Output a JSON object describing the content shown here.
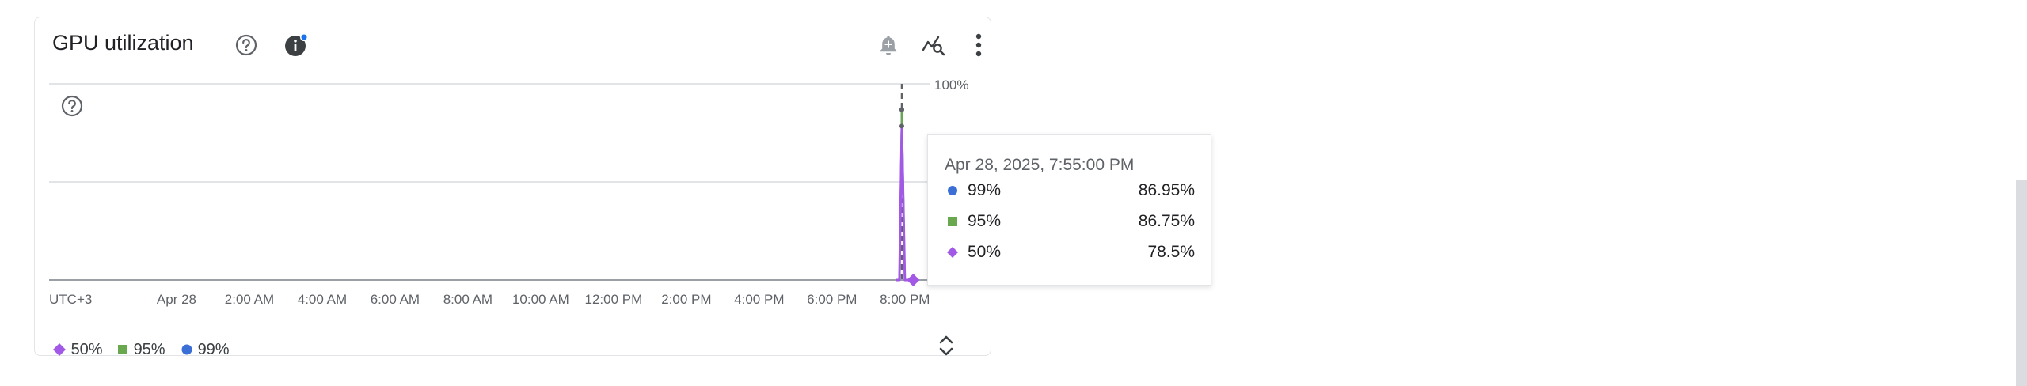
{
  "card": {
    "title": "GPU utilization",
    "icons": [
      "help-icon",
      "info-icon",
      "add-alert-icon",
      "explore-query-icon",
      "more-vert-icon",
      "chart-help-icon",
      "expand-collapse-icon"
    ]
  },
  "colors": {
    "p50": "#a259e6",
    "p95": "#6aa84f",
    "p99": "#3b6fd6",
    "grid": "#dadce0",
    "text": "#5f6368"
  },
  "tooltip": {
    "timestamp": "Apr 28, 2025, 7:55:00 PM",
    "rows": [
      {
        "name": "99%",
        "value": "86.95%",
        "marker": "circle"
      },
      {
        "name": "95%",
        "value": "86.75%",
        "marker": "square"
      },
      {
        "name": "50%",
        "value": "78.5%",
        "marker": "diamond"
      }
    ]
  },
  "legend": [
    {
      "name": "50%",
      "marker": "diamond"
    },
    {
      "name": "95%",
      "marker": "square"
    },
    {
      "name": "99%",
      "marker": "circle"
    }
  ],
  "chart_data": {
    "type": "line",
    "timezone_label": "UTC+3",
    "x_tick_labels": [
      "Apr 28",
      "2:00 AM",
      "4:00 AM",
      "6:00 AM",
      "8:00 AM",
      "10:00 AM",
      "12:00 PM",
      "2:00 PM",
      "4:00 PM",
      "6:00 PM",
      "8:00 PM"
    ],
    "x_hours": [
      0,
      2,
      4,
      6,
      8,
      10,
      12,
      14,
      16,
      18,
      20
    ],
    "x_range_hours": [
      -3.5,
      20.7
    ],
    "ylim": [
      0,
      100
    ],
    "y_tick_labels": [
      "100%"
    ],
    "grid": true,
    "legend_position": "bottom-left",
    "hover_time_hours": 19.9167,
    "series": [
      {
        "name": "50%",
        "x_hours": [
          19.75,
          19.85,
          19.9167,
          20.0,
          20.1
        ],
        "values": [
          0,
          0,
          78.5,
          0,
          0
        ]
      },
      {
        "name": "95%",
        "x_hours": [
          19.75,
          19.85,
          19.9167,
          20.0,
          20.1
        ],
        "values": [
          0,
          0,
          86.75,
          0,
          0
        ]
      },
      {
        "name": "99%",
        "x_hours": [
          19.75,
          19.85,
          19.9167,
          20.0,
          20.1
        ],
        "values": [
          0,
          0,
          86.95,
          0,
          0
        ]
      }
    ]
  }
}
